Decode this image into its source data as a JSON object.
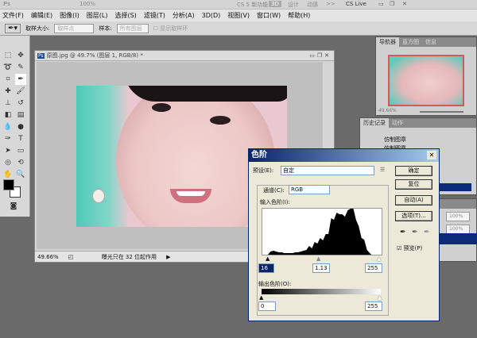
{
  "appbar": {
    "logo": "Ps",
    "zoom": "100%",
    "workspace": "CS 5 新功能",
    "ws_3d": "3D",
    "ws_design": "设计",
    "ws_motion": "动感",
    "more": ">>",
    "cslive": "CS Live"
  },
  "menu": [
    "文件(F)",
    "编辑(E)",
    "图像(I)",
    "图层(L)",
    "选择(S)",
    "滤镜(T)",
    "分析(A)",
    "3D(D)",
    "视图(V)",
    "窗口(W)",
    "帮助(H)"
  ],
  "options": {
    "sample_size_label": "取样大小:",
    "sample_size": "取样点",
    "sample_label": "样本:",
    "sample": "所有图层",
    "show_ring": "显示取样环"
  },
  "document": {
    "title": "原图.jpg @ 49.7% (图层 1, RGB/8) *",
    "zoom": "49.66%",
    "status": "曝光只在 32 位起作用"
  },
  "navigator": {
    "tabs": [
      "导航器",
      "直方图",
      "信息"
    ],
    "zoom": "49.66%"
  },
  "history": {
    "tabs": [
      "历史记录",
      "动作"
    ],
    "items": [
      "仿制图章",
      "仿制图章"
    ]
  },
  "layers": {
    "opacity": "100%",
    "fill": "100%"
  },
  "levels": {
    "title": "色阶",
    "preset_label": "预设(E):",
    "preset": "自定",
    "channel_label": "通道(C):",
    "channel": "RGB",
    "input_label": "输入色阶(I):",
    "input_black": "16",
    "input_gamma": "1.13",
    "input_white": "255",
    "output_label": "输出色阶(O):",
    "output_black": "0",
    "output_white": "255",
    "ok": "确定",
    "reset": "复位",
    "auto": "自动(A)",
    "options": "选项(T)...",
    "preview": "预览(P)",
    "preview_checked": true
  }
}
